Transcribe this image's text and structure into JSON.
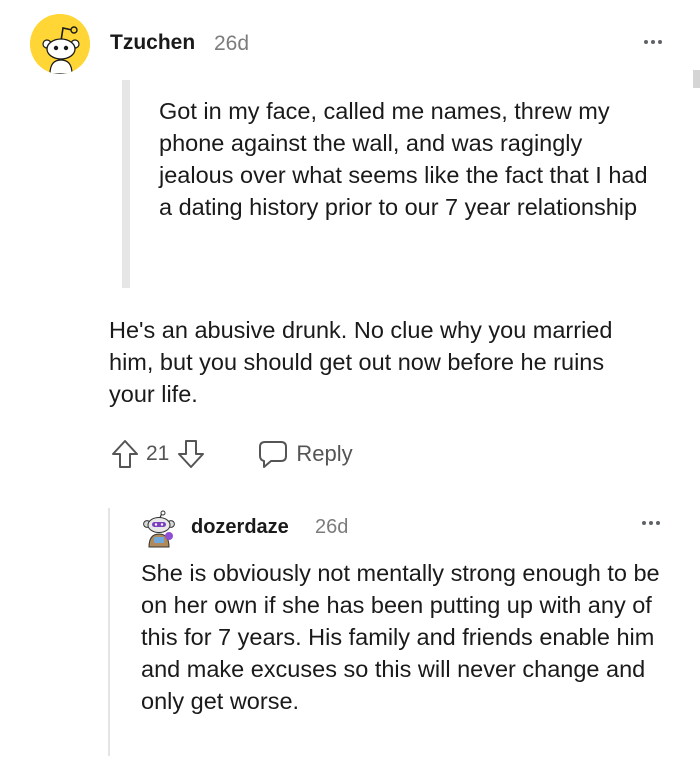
{
  "comment": {
    "author": "Tzuchen",
    "age": "26d",
    "quote": "Got in my face, called me names, threw my phone against the wall, and was ragingly jealous over what seems like the fact that I had a dating history prior to our 7 year relationship",
    "body": "He's an abusive drunk. No clue why you married him, but you should get out now before he ruins your life.",
    "score": "21",
    "reply_label": "Reply",
    "avatar_color": "#ffd635"
  },
  "reply": {
    "author": "dozerdaze",
    "age": "26d",
    "body": "She is obviously not mentally strong enough to be on her own if she has been putting up with any of this for 7 years. His family and friends enable him and make excuses so this will never change and only get worse."
  },
  "icons": {
    "upvote": "arrow-up-outline-icon",
    "downvote": "arrow-down-outline-icon",
    "reply": "speech-bubble-icon",
    "more": "more-horizontal-icon"
  }
}
